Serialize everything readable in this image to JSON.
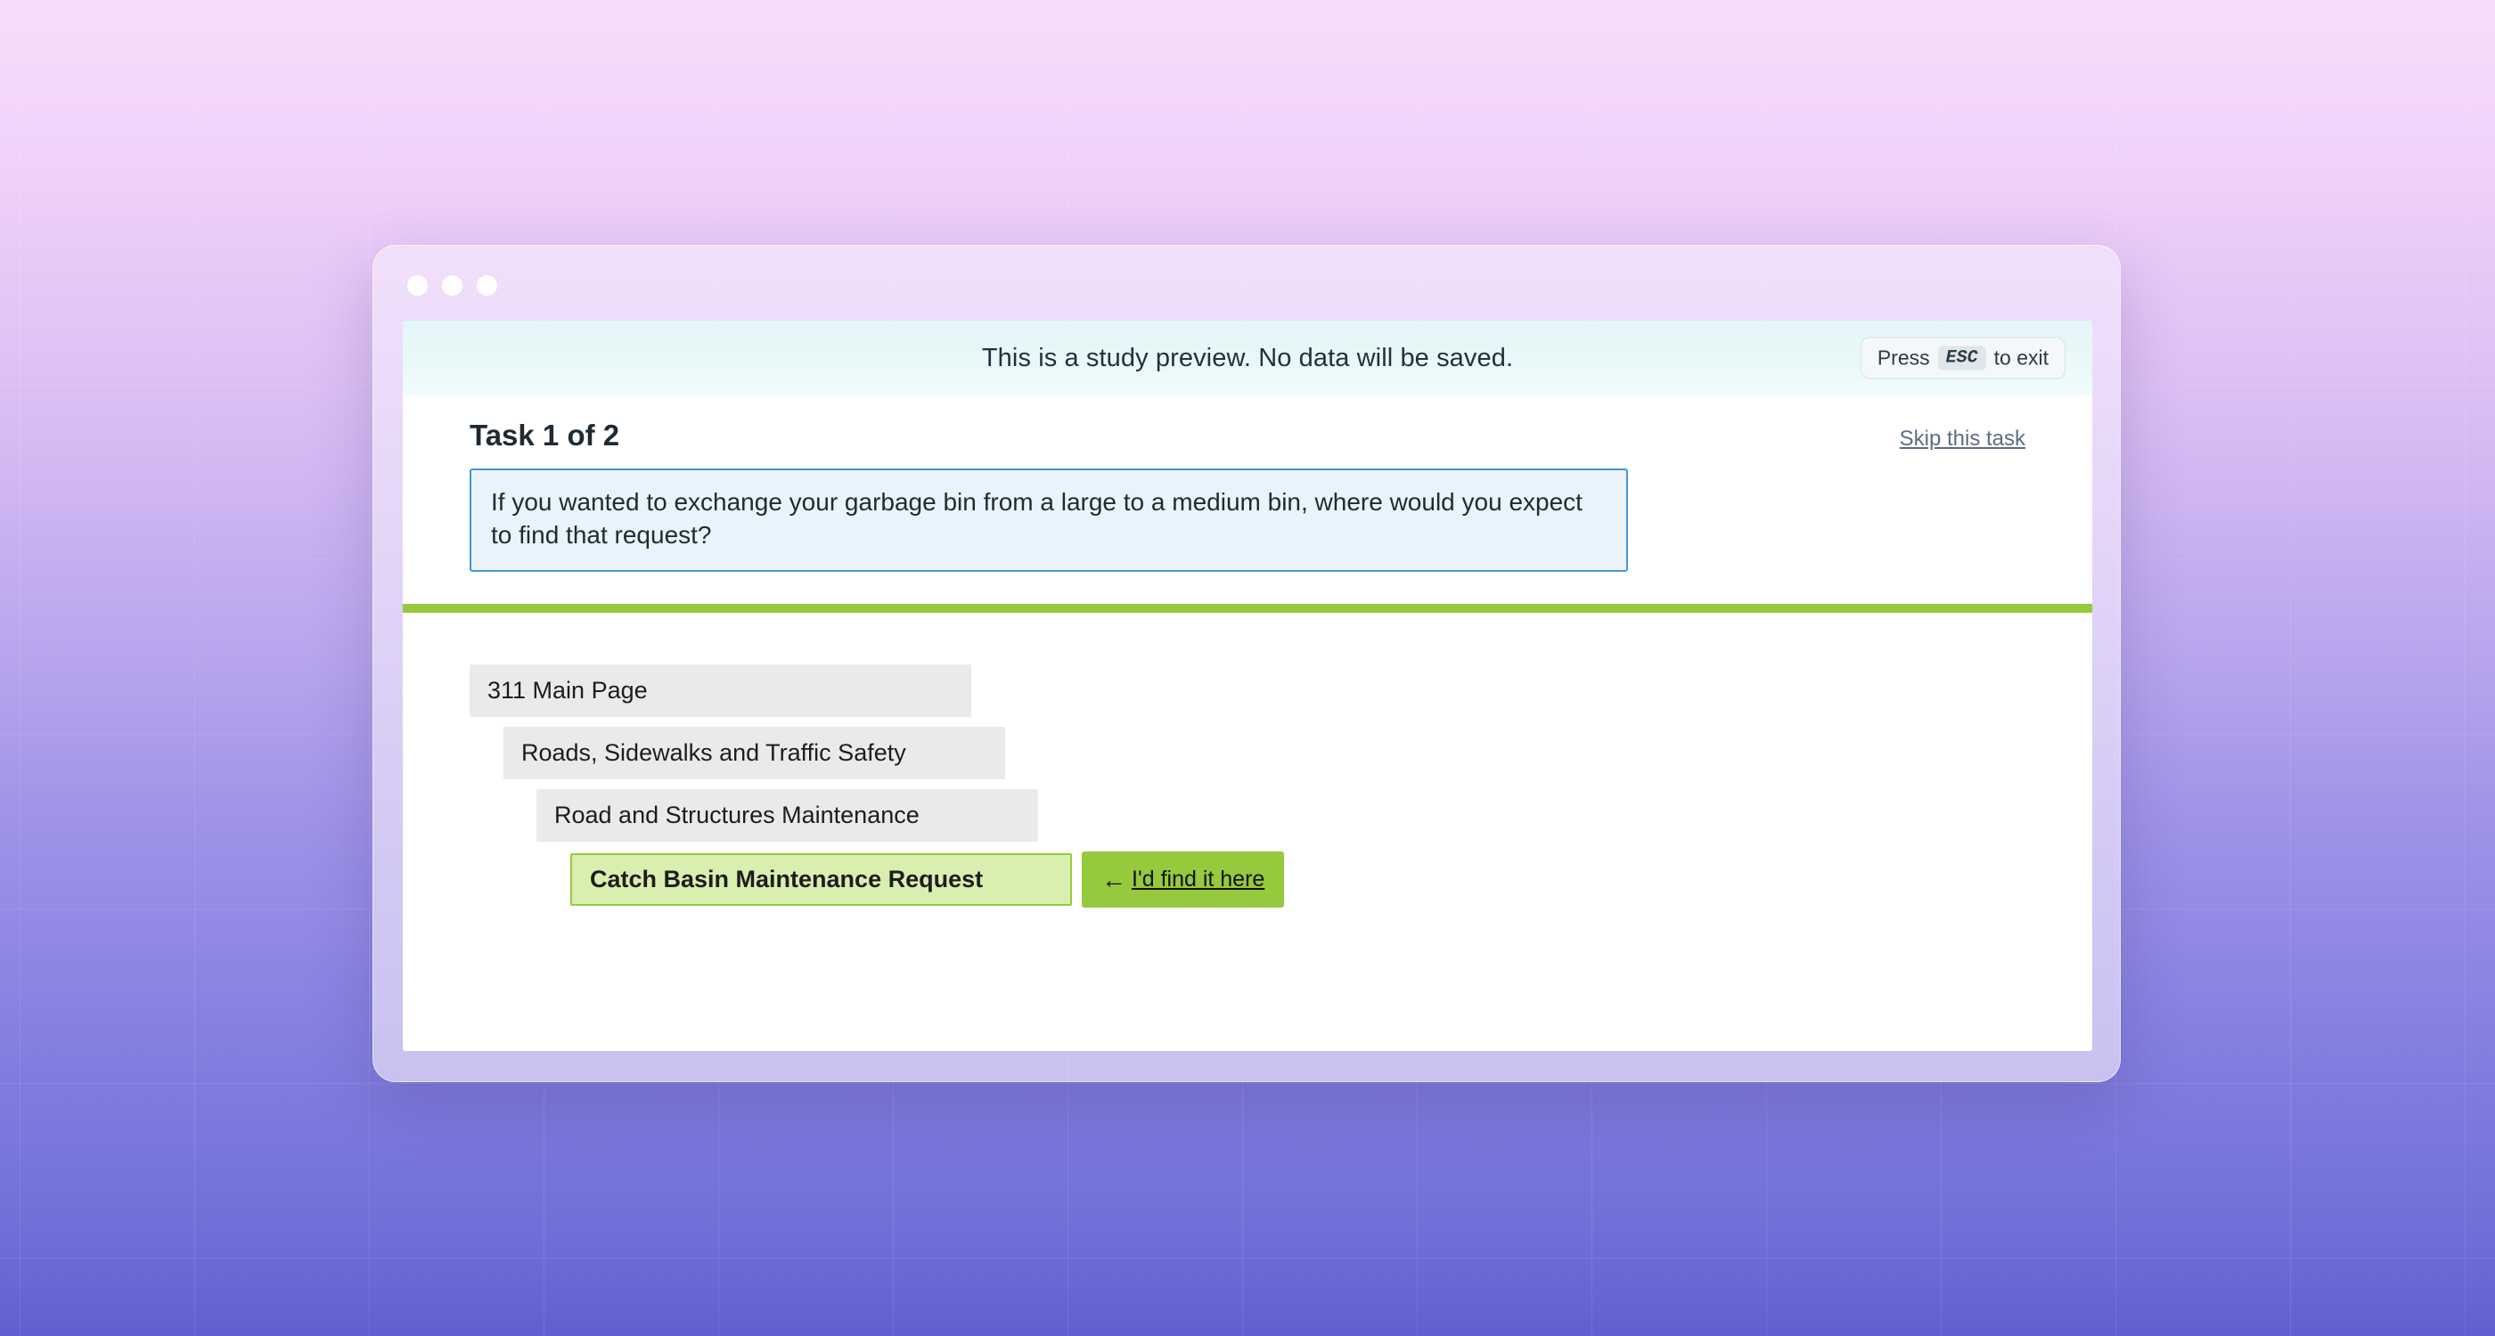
{
  "window": {
    "traffic_lights": [
      "close",
      "minimize",
      "maximize"
    ]
  },
  "banner": {
    "message": "This is a study preview. No data will be saved.",
    "esc_prefix": "Press",
    "esc_key": "ESC",
    "esc_suffix": "to exit"
  },
  "task": {
    "title": "Task 1 of 2",
    "skip_label": "Skip this task",
    "question": "If you wanted to exchange your garbage bin from a large to a medium bin, where would you expect to find that request?"
  },
  "tree": {
    "items": [
      {
        "label": "311 Main Page",
        "level": 0,
        "selected": false
      },
      {
        "label": "Roads, Sidewalks and Traffic Safety",
        "level": 1,
        "selected": false
      },
      {
        "label": "Road and Structures Maintenance",
        "level": 2,
        "selected": false
      },
      {
        "label": "Catch Basin Maintenance Request",
        "level": 3,
        "selected": true
      }
    ],
    "confirm_button": {
      "arrow": "←",
      "label": "I'd find it here"
    }
  },
  "colors": {
    "accent_green": "#96c93d",
    "selected_fill": "#d9efb0",
    "item_gray": "#eaeaea",
    "question_border": "#4297d4",
    "question_fill": "#e9f3fc",
    "banner_fill": "#e4f6f8",
    "link": "#5c6d85"
  }
}
